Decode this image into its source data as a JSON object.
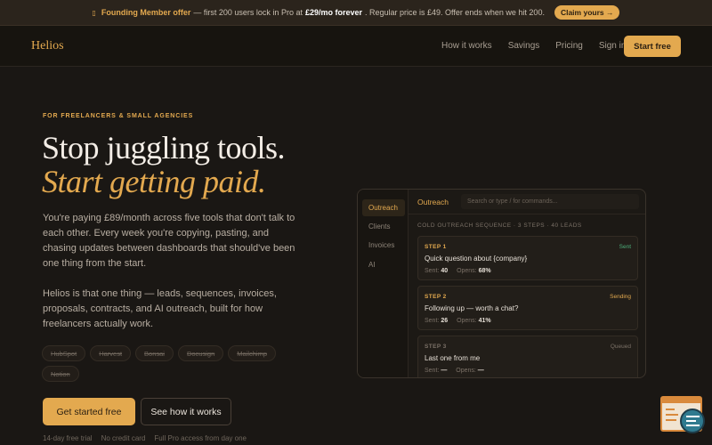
{
  "banner": {
    "icon": "flag-icon",
    "lead": "Founding Member offer",
    "text_a": "— first 200 users lock in Pro at",
    "price": "£29/mo forever",
    "text_b": ". Regular price is £49. Offer ends when we hit 200.",
    "claim": "Claim yours →"
  },
  "nav": {
    "logo": "Helios",
    "links": [
      "How it works",
      "Savings",
      "Pricing",
      "Sign in"
    ],
    "cta": "Start free"
  },
  "hero": {
    "eyebrow": "FOR FREELANCERS & SMALL AGENCIES",
    "headline_1": "Stop juggling tools.",
    "headline_2": "Start getting paid.",
    "para_1": "You're paying £89/month across five tools that don't talk to each other. Every week you're copying, pasting, and chasing updates between dashboards that should've been one thing from the start.",
    "para_2": "Helios is that one thing — leads, sequences, invoices, proposals, contracts, and AI outreach, built for how freelancers actually work.",
    "tools": [
      "HubSpot",
      "Harvest",
      "Bonsai",
      "Docusign",
      "Mailchimp",
      "Notion"
    ],
    "cta_primary": "Get started free",
    "cta_secondary": "See how it works",
    "fineprint": [
      "14-day free trial",
      "No credit card",
      "Full Pro access from day one"
    ]
  },
  "app": {
    "sidebar": [
      "Outreach",
      "Clients",
      "Invoices",
      "AI"
    ],
    "title": "Outreach",
    "search_placeholder": "Search or type / for commands...",
    "sequence_label": "COLD OUTREACH SEQUENCE · 3 STEPS · 40 LEADS",
    "steps": [
      {
        "num": "STEP 1",
        "status": "Sent",
        "status_color": "#4caf7a",
        "subject": "Quick question about {company}",
        "sent_label": "Sent:",
        "sent": "40",
        "opens_label": "Opens:",
        "opens": "68%"
      },
      {
        "num": "STEP 2",
        "status": "Sending",
        "status_color": "#e3a94f",
        "subject": "Following up — worth a chat?",
        "sent_label": "Sent:",
        "sent": "26",
        "opens_label": "Opens:",
        "opens": "41%"
      },
      {
        "num": "STEP 3",
        "status": "Queued",
        "status_color": "#7c7268",
        "subject": "Last one from me",
        "sent_label": "Sent:",
        "sent": "—",
        "opens_label": "Opens:",
        "opens": "—"
      }
    ]
  },
  "colors": {
    "accent": "#e3a94f",
    "background": "#1a1714"
  }
}
